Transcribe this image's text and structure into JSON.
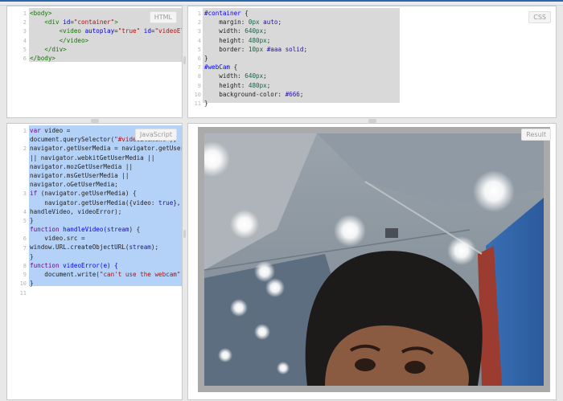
{
  "html_pane": {
    "label": "HTML",
    "line_numbers": [
      "1",
      "2",
      "3",
      "4",
      "5",
      "6"
    ],
    "lines": [
      [
        {
          "t": "<body>",
          "c": "tag"
        }
      ],
      [
        {
          "t": "    <div ",
          "c": "tag"
        },
        {
          "t": "id",
          "c": "attr"
        },
        {
          "t": "=",
          "c": "prop"
        },
        {
          "t": "\"container\"",
          "c": "str"
        },
        {
          "t": ">",
          "c": "tag"
        }
      ],
      [
        {
          "t": "        <video ",
          "c": "tag"
        },
        {
          "t": "autoplay",
          "c": "attr"
        },
        {
          "t": "=",
          "c": "prop"
        },
        {
          "t": "\"true\" ",
          "c": "str"
        },
        {
          "t": "id",
          "c": "attr"
        },
        {
          "t": "=",
          "c": "prop"
        },
        {
          "t": "\"videoElement\"",
          "c": "str"
        },
        {
          "t": ">",
          "c": "tag"
        }
      ],
      [
        {
          "t": "        </video>",
          "c": "tag"
        }
      ],
      [
        {
          "t": "    </div>",
          "c": "tag"
        }
      ],
      [
        {
          "t": "</body>",
          "c": "tag"
        }
      ]
    ]
  },
  "css_pane": {
    "label": "CSS",
    "line_numbers": [
      "1",
      "2",
      "3",
      "4",
      "5",
      "6",
      "7",
      "8",
      "9",
      "10",
      "11"
    ],
    "lines": [
      [
        {
          "t": "#container",
          "c": "def"
        },
        {
          "t": " {",
          "c": "prop"
        }
      ],
      [
        {
          "t": "    margin: ",
          "c": "prop"
        },
        {
          "t": "0px ",
          "c": "num"
        },
        {
          "t": "auto",
          "c": "atom"
        },
        {
          "t": ";",
          "c": "prop"
        }
      ],
      [
        {
          "t": "    width: ",
          "c": "prop"
        },
        {
          "t": "640px",
          "c": "num"
        },
        {
          "t": ";",
          "c": "prop"
        }
      ],
      [
        {
          "t": "    height: ",
          "c": "prop"
        },
        {
          "t": "480px",
          "c": "num"
        },
        {
          "t": ";",
          "c": "prop"
        }
      ],
      [
        {
          "t": "    border: ",
          "c": "prop"
        },
        {
          "t": "10px ",
          "c": "num"
        },
        {
          "t": "#aaa ",
          "c": "atom"
        },
        {
          "t": "solid",
          "c": "atom"
        },
        {
          "t": ";",
          "c": "prop"
        }
      ],
      [
        {
          "t": "}",
          "c": "prop"
        }
      ],
      [
        {
          "t": "#webCam",
          "c": "def"
        },
        {
          "t": " {",
          "c": "prop"
        }
      ],
      [
        {
          "t": "    width: ",
          "c": "prop"
        },
        {
          "t": "640px",
          "c": "num"
        },
        {
          "t": ";",
          "c": "prop"
        }
      ],
      [
        {
          "t": "    height: ",
          "c": "prop"
        },
        {
          "t": "480px",
          "c": "num"
        },
        {
          "t": ";",
          "c": "prop"
        }
      ],
      [
        {
          "t": "    background-color: ",
          "c": "prop"
        },
        {
          "t": "#666",
          "c": "atom"
        },
        {
          "t": ";",
          "c": "prop"
        }
      ],
      [
        {
          "t": "}",
          "c": "prop"
        }
      ]
    ]
  },
  "js_pane": {
    "label": "JavaScript",
    "line_numbers": [
      "1",
      "",
      "2",
      "",
      "",
      "",
      "",
      "3",
      "",
      "4",
      "5",
      "",
      "6",
      "7",
      "",
      "8",
      "9",
      "10",
      "11"
    ],
    "lines": [
      [
        {
          "t": "var ",
          "c": "kw"
        },
        {
          "t": "video =",
          "c": "prop"
        }
      ],
      [
        {
          "t": "document.querySelector(",
          "c": "prop"
        },
        {
          "t": "\"#videoElement\"",
          "c": "str"
        },
        {
          "t": ");",
          "c": "prop"
        }
      ],
      [
        {
          "t": "navigator.getUserMedia = navigator.getUserMedia",
          "c": "prop"
        }
      ],
      [
        {
          "t": "|| navigator.webkitGetUserMedia ||",
          "c": "prop"
        }
      ],
      [
        {
          "t": "navigator.mozGetUserMedia ||",
          "c": "prop"
        }
      ],
      [
        {
          "t": "navigator.msGetUserMedia ||",
          "c": "prop"
        }
      ],
      [
        {
          "t": "navigator.oGetUserMedia;",
          "c": "prop"
        }
      ],
      [
        {
          "t": "if ",
          "c": "kw"
        },
        {
          "t": "(navigator.getUserMedia) {",
          "c": "prop"
        }
      ],
      [
        {
          "t": "    navigator.getUserMedia({video: ",
          "c": "prop"
        },
        {
          "t": "true",
          "c": "atom"
        },
        {
          "t": "},",
          "c": "prop"
        }
      ],
      [
        {
          "t": "handleVideo, videoError);",
          "c": "prop"
        }
      ],
      [
        {
          "t": "}",
          "c": "prop"
        }
      ],
      [
        {
          "t": "function ",
          "c": "kw"
        },
        {
          "t": "handleVideo(",
          "c": "def"
        },
        {
          "t": "stream",
          "c": "atom"
        },
        {
          "t": ") {",
          "c": "prop"
        }
      ],
      [
        {
          "t": "    video.src =",
          "c": "prop"
        }
      ],
      [
        {
          "t": "window.URL.createObjectURL(",
          "c": "prop"
        },
        {
          "t": "stream",
          "c": "atom"
        },
        {
          "t": ");",
          "c": "prop"
        }
      ],
      [
        {
          "t": "}",
          "c": "prop"
        }
      ],
      [
        {
          "t": "function ",
          "c": "kw"
        },
        {
          "t": "videoError(e) {",
          "c": "def"
        }
      ],
      [
        {
          "t": "    document.write(",
          "c": "prop"
        },
        {
          "t": "\"can't use the webcam\"",
          "c": "str"
        },
        {
          "t": ");",
          "c": "prop"
        }
      ],
      [
        {
          "t": "}",
          "c": "prop"
        }
      ]
    ]
  },
  "result_pane": {
    "label": "Result"
  },
  "colors": {
    "accent": "#2a67a8",
    "selection": "#b4d2f8",
    "frame_border": "#aaaaaa"
  }
}
